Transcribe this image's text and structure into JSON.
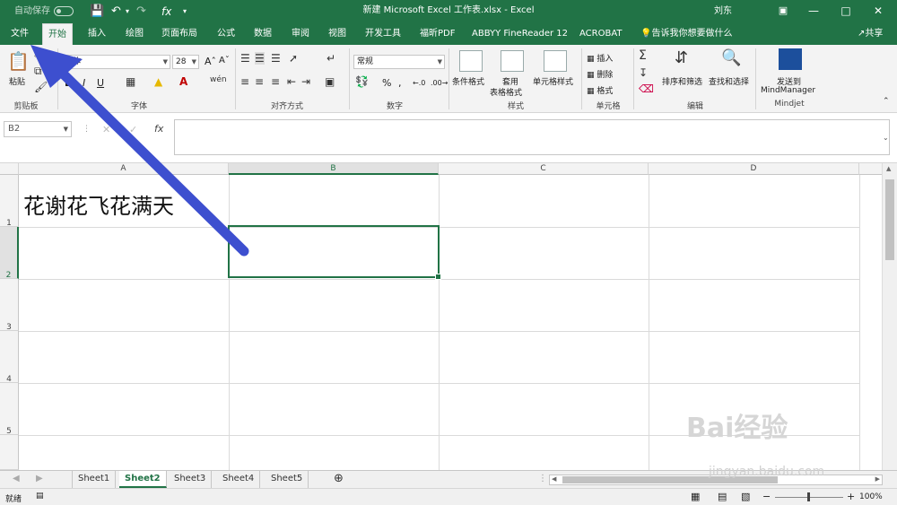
{
  "titlebar": {
    "autosave_label": "自动保存",
    "autosave_state": "关",
    "title": "新建 Microsoft Excel 工作表.xlsx  -  Excel",
    "user": "刘东"
  },
  "tabs": [
    {
      "label": "文件"
    },
    {
      "label": "开始"
    },
    {
      "label": "插入"
    },
    {
      "label": "绘图"
    },
    {
      "label": "页面布局"
    },
    {
      "label": "公式"
    },
    {
      "label": "数据"
    },
    {
      "label": "审阅"
    },
    {
      "label": "视图"
    },
    {
      "label": "开发工具"
    },
    {
      "label": "福昕PDF"
    },
    {
      "label": "ABBYY FineReader 12"
    },
    {
      "label": "ACROBAT"
    }
  ],
  "tell_me": "告诉我你想要做什么",
  "share": "共享",
  "ribbon": {
    "clipboard": {
      "paste": "粘贴",
      "group": "剪贴板"
    },
    "font": {
      "name": "宋体",
      "size": "28",
      "group": "字体",
      "bold": "B",
      "italic": "I",
      "underline": "U"
    },
    "alignment": {
      "group": "对齐方式"
    },
    "number": {
      "format": "常规",
      "group": "数字",
      "percent": "%"
    },
    "styles": {
      "conditional": "条件格式",
      "table1": "套用",
      "table2": "表格格式",
      "cell_styles": "单元格样式",
      "group": "样式"
    },
    "cells": {
      "insert": "插入",
      "delete": "删除",
      "format": "格式",
      "group": "单元格"
    },
    "editing": {
      "sort": "排序和筛选",
      "find": "查找和选择",
      "group": "编辑"
    },
    "mindjet": {
      "send1": "发送到",
      "send2": "MindManager",
      "group": "Mindjet"
    }
  },
  "formula_bar": {
    "name_box": "B2",
    "fx": "fx",
    "content": ""
  },
  "columns": [
    "A",
    "B",
    "C",
    "D"
  ],
  "rows": [
    "1",
    "2",
    "3",
    "4",
    "5"
  ],
  "cells": {
    "A1": "花谢花飞花满天"
  },
  "selected_cell": "B2",
  "sheets": [
    "Sheet1",
    "Sheet2",
    "Sheet3",
    "Sheet4",
    "Sheet5"
  ],
  "active_sheet": "Sheet2",
  "status": {
    "ready": "就绪",
    "zoom": "100%"
  },
  "watermark": {
    "brand": "Bai经验",
    "url": "jingyan.baidu.com"
  },
  "colors": {
    "excel_green": "#217346",
    "arrow": "#3d4fcf"
  }
}
